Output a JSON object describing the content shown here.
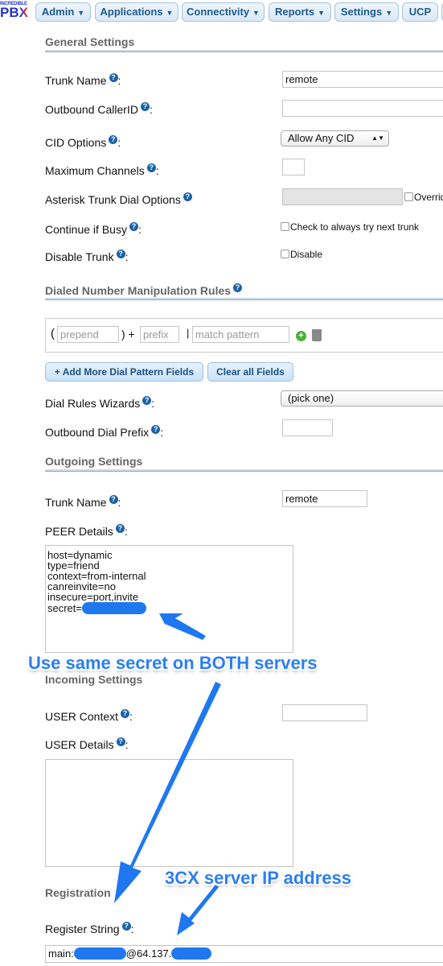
{
  "nav": {
    "logo": "INCREDIBLE PBX",
    "logo_small": "INCREDIBLE",
    "logo_big": "PBX",
    "tabs": [
      {
        "label": "Admin"
      },
      {
        "label": "Applications"
      },
      {
        "label": "Connectivity"
      },
      {
        "label": "Reports"
      },
      {
        "label": "Settings"
      },
      {
        "label": "UCP"
      }
    ]
  },
  "general": {
    "heading": "General Settings",
    "trunk_name": {
      "label": "Trunk Name",
      "value": "remote"
    },
    "outbound_callerid": {
      "label": "Outbound CallerID",
      "value": ""
    },
    "cid_options": {
      "label": "CID Options",
      "value": "Allow Any CID"
    },
    "max_channels": {
      "label": "Maximum Channels",
      "value": ""
    },
    "dial_options": {
      "label": "Asterisk Trunk Dial Options",
      "override": "Override"
    },
    "continue_busy": {
      "label": "Continue if Busy",
      "checkbox": "Check to always try next trunk"
    },
    "disable_trunk": {
      "label": "Disable Trunk",
      "checkbox": "Disable"
    }
  },
  "dial_rules": {
    "heading": "Dialed Number Manipulation Rules",
    "prepend_placeholder": "prepend",
    "prefix_placeholder": "prefix",
    "pattern_placeholder": "match pattern",
    "open": "(",
    "plus": ") +",
    "pipe": "|",
    "add_button": "+ Add More Dial Pattern Fields",
    "clear_button": "Clear all Fields",
    "wizards": {
      "label": "Dial Rules Wizards",
      "value": "(pick one)"
    },
    "outbound_prefix": {
      "label": "Outbound Dial Prefix",
      "value": ""
    }
  },
  "outgoing": {
    "heading": "Outgoing Settings",
    "trunk_name": {
      "label": "Trunk Name",
      "value": "remote"
    },
    "peer_label": "PEER Details",
    "peer_details": "host=dynamic\ntype=friend\ncontext=from-internal\ncanreinvite=no\ninsecure=port,invite\nsecret="
  },
  "incoming": {
    "heading": "Incoming Settings",
    "user_context": {
      "label": "USER Context",
      "value": ""
    },
    "user_details_label": "USER Details",
    "user_details": ""
  },
  "registration": {
    "heading": "Registration",
    "label": "Register String",
    "value_prefix": "main:",
    "value_mid": "@64.137."
  },
  "annotations": {
    "secret_note": "Use same secret on BOTH servers",
    "ip_note": "3CX server IP address",
    "color": "#2b7ff2"
  }
}
